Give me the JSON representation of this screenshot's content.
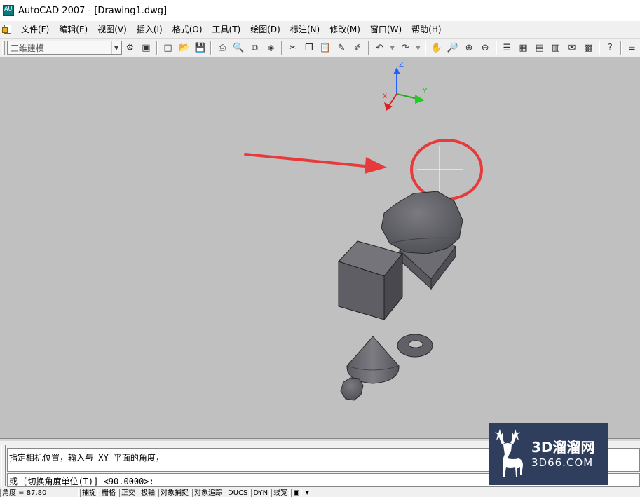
{
  "window": {
    "title": "AutoCAD 2007 - [Drawing1.dwg]",
    "app_icon_text": "AU"
  },
  "menu": {
    "items": [
      "文件(F)",
      "编辑(E)",
      "视图(V)",
      "插入(I)",
      "格式(O)",
      "工具(T)",
      "绘图(D)",
      "标注(N)",
      "修改(M)",
      "窗口(W)",
      "帮助(H)"
    ]
  },
  "toolbar": {
    "workspace": "三维建模",
    "icons": [
      "workspace-settings-icon",
      "my-workspace-icon",
      "new-icon",
      "open-icon",
      "save-icon",
      "plot-icon",
      "plot-preview-icon",
      "publish-icon",
      "3d-dwf-icon",
      "cut-icon",
      "copy-icon",
      "paste-icon",
      "match-properties-icon",
      "block-editor-icon",
      "undo-icon",
      "redo-icon",
      "pan-icon",
      "zoom-realtime-icon",
      "zoom-window-icon",
      "zoom-previous-icon",
      "properties-icon",
      "design-center-icon",
      "tool-palettes-icon",
      "sheet-set-icon",
      "markup-icon",
      "quickcalc-icon",
      "help-icon"
    ]
  },
  "viewport": {
    "background": "#c0c0c0",
    "ucs_labels": {
      "z": "Z",
      "y": "Y",
      "x": "X"
    },
    "annotation_color": "#e83a3a"
  },
  "command": {
    "history": "指定相机位置，输入与 XY 平面的角度，",
    "prompt": "或 [切换角度单位(T)] <90.0000>:"
  },
  "status": {
    "coords": "角度 = 87.80",
    "toggles": [
      "捕捉",
      "栅格",
      "正交",
      "极轴",
      "对象捕捉",
      "对象追踪",
      "DUCS",
      "DYN",
      "线宽"
    ]
  },
  "watermark": {
    "title": "3D溜溜网",
    "domain": "3D66.COM"
  }
}
